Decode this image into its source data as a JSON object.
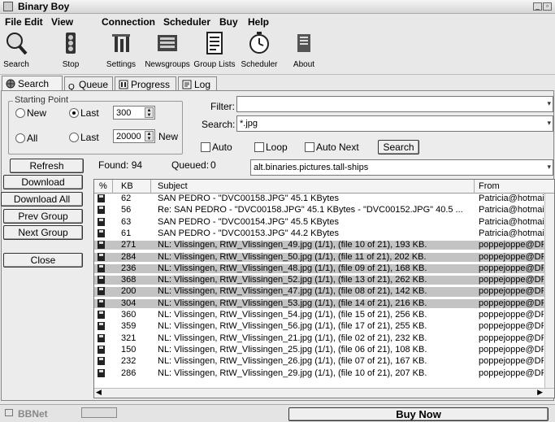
{
  "window": {
    "title": "Binary Boy"
  },
  "menu": [
    "File",
    "Edit",
    "View",
    "Connection",
    "Scheduler",
    "Buy",
    "Help"
  ],
  "toolbar": [
    {
      "label": "Search",
      "icon": "magnifier-icon"
    },
    {
      "label": "Stop",
      "icon": "traffic-light-icon"
    },
    {
      "label": "Settings",
      "icon": "settings-icon"
    },
    {
      "label": "Newsgroups",
      "icon": "newsgroups-icon"
    },
    {
      "label": "Group Lists",
      "icon": "group-list-icon"
    },
    {
      "label": "Scheduler",
      "icon": "clock-icon"
    },
    {
      "label": "About",
      "icon": "about-icon"
    }
  ],
  "tabs": [
    {
      "label": "Search",
      "icon": "globe-icon",
      "active": true
    },
    {
      "label": "Queue",
      "icon": "queue-icon",
      "active": false
    },
    {
      "label": "Progress",
      "icon": "progress-icon",
      "active": false
    },
    {
      "label": "Log",
      "icon": "log-icon",
      "active": false
    }
  ],
  "starting_point": {
    "title": "Starting Point",
    "new_label": "New",
    "last_label": "Last",
    "last_value": "300",
    "all_label": "All",
    "last2_label": "Last",
    "last2_value": "20000",
    "new2_label": "New",
    "selected": "last"
  },
  "filter": {
    "label": "Filter:",
    "value": ""
  },
  "search": {
    "label": "Search:",
    "value": "*.jpg"
  },
  "options": {
    "auto_label": "Auto",
    "loop_label": "Loop",
    "auto_next_label": "Auto Next",
    "search_button": "Search"
  },
  "status": {
    "refresh_button": "Refresh",
    "found_text": "Found: 94",
    "queued_label": "Queued:",
    "queued_value": "0",
    "group": "alt.binaries.pictures.tall-ships"
  },
  "side_buttons": [
    "Download",
    "Download All",
    "Prev Group",
    "Next Group",
    "Close"
  ],
  "table": {
    "columns": [
      "%",
      "KB",
      "Subject",
      "From"
    ],
    "rows": [
      {
        "kb": "62",
        "subject": "SAN PEDRO - \"DVC00158.JPG\" 45.1 KBytes",
        "from": "Patricia@hotmails",
        "selected": false
      },
      {
        "kb": "56",
        "subject": "Re: SAN PEDRO - \"DVC00158.JPG\" 45.1 KBytes - \"DVC00152.JPG\" 40.5 ...",
        "from": "Patricia@hotmails",
        "selected": false
      },
      {
        "kb": "63",
        "subject": "SAN PEDRO - \"DVC00154.JPG\" 45.5 KBytes",
        "from": "Patricia@hotmails",
        "selected": false
      },
      {
        "kb": "61",
        "subject": "SAN PEDRO - \"DVC00153.JPG\" 44.2 KBytes",
        "from": "Patricia@hotmails",
        "selected": false
      },
      {
        "kb": "271",
        "subject": "NL: Vlissingen, RtW_Vlissingen_49.jpg (1/1), (file 10 of 21), 193 KB.",
        "from": "poppejoppe@DF",
        "selected": true
      },
      {
        "kb": "284",
        "subject": "NL: Vlissingen, RtW_Vlissingen_50.jpg (1/1), (file 11 of 21), 202 KB.",
        "from": "poppejoppe@DF",
        "selected": true
      },
      {
        "kb": "236",
        "subject": "NL: Vlissingen, RtW_Vlissingen_48.jpg (1/1), (file 09 of 21), 168 KB.",
        "from": "poppejoppe@DF",
        "selected": true
      },
      {
        "kb": "368",
        "subject": "NL: Vlissingen, RtW_Vlissingen_52.jpg (1/1), (file 13 of 21), 262 KB.",
        "from": "poppejoppe@DF",
        "selected": true
      },
      {
        "kb": "200",
        "subject": "NL: Vlissingen, RtW_Vlissingen_47.jpg (1/1), (file 08 of 21), 142 KB.",
        "from": "poppejoppe@DF",
        "selected": true
      },
      {
        "kb": "304",
        "subject": "NL: Vlissingen, RtW_Vlissingen_53.jpg (1/1), (file 14 of 21), 216 KB.",
        "from": "poppejoppe@DF",
        "selected": true
      },
      {
        "kb": "360",
        "subject": "NL: Vlissingen, RtW_Vlissingen_54.jpg (1/1), (file 15 of 21), 256 KB.",
        "from": "poppejoppe@DF",
        "selected": false
      },
      {
        "kb": "359",
        "subject": "NL: Vlissingen, RtW_Vlissingen_56.jpg (1/1), (file 17 of 21), 255 KB.",
        "from": "poppejoppe@DF",
        "selected": false
      },
      {
        "kb": "321",
        "subject": "NL: Vlissingen, RtW_Vlissingen_21.jpg (1/1), (file 02 of 21), 232 KB.",
        "from": "poppejoppe@DF",
        "selected": false
      },
      {
        "kb": "150",
        "subject": "NL: Vlissingen, RtW_Vlissingen_25.jpg (1/1), (file 06 of 21), 108 KB.",
        "from": "poppejoppe@DF",
        "selected": false
      },
      {
        "kb": "232",
        "subject": "NL: Vlissingen, RtW_Vlissingen_26.jpg (1/1), (file 07 of 21), 167 KB.",
        "from": "poppejoppe@DF",
        "selected": false
      },
      {
        "kb": "286",
        "subject": "NL: Vlissingen, RtW_Vlissingen_29.jpg (1/1), (file 10 of 21), 207 KB.",
        "from": "poppejoppe@DF",
        "selected": false
      }
    ]
  },
  "statusbar": {
    "left_text": "BBNet",
    "right_button": "Buy Now"
  }
}
